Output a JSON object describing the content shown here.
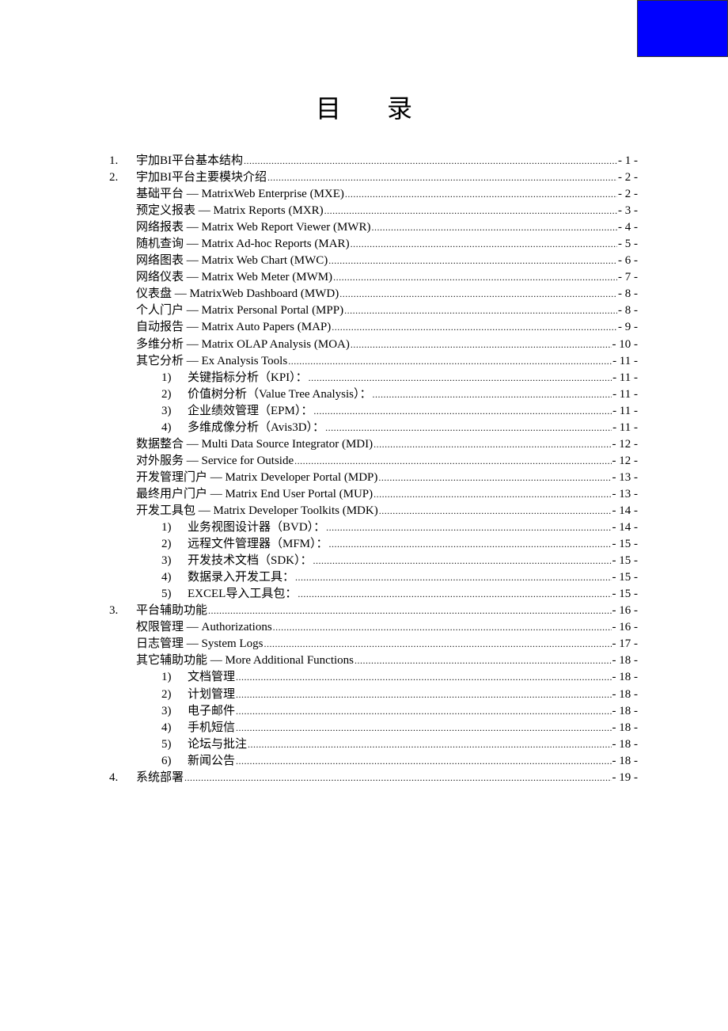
{
  "page": {
    "title_chars": [
      "目",
      "录"
    ],
    "corner_block_color": "#0000ff"
  },
  "toc": [
    {
      "level": 1,
      "num": "1.",
      "label": "宇加BI平台基本结构",
      "page": "- 1 -"
    },
    {
      "level": 1,
      "num": "2.",
      "label": "宇加BI平台主要模块介绍",
      "page": "- 2 -"
    },
    {
      "level": 2,
      "num": "",
      "label": "基础平台  — MatrixWeb Enterprise (MXE)",
      "page": "- 2 -"
    },
    {
      "level": 2,
      "num": "",
      "label": "预定义报表  — Matrix Reports (MXR)",
      "page": "- 3 -"
    },
    {
      "level": 2,
      "num": "",
      "label": "网络报表  — Matrix Web Report Viewer (MWR)",
      "page": "- 4 -"
    },
    {
      "level": 2,
      "num": "",
      "label": "随机查询  — Matrix Ad-hoc Reports (MAR)",
      "page": "- 5 -"
    },
    {
      "level": 2,
      "num": "",
      "label": "网络图表  — Matrix Web Chart (MWC)",
      "page": "- 6 -"
    },
    {
      "level": 2,
      "num": "",
      "label": "网络仪表  — Matrix Web Meter (MWM)",
      "page": "- 7 -"
    },
    {
      "level": 2,
      "num": "",
      "label": "仪表盘  — MatrixWeb Dashboard (MWD)",
      "page": "- 8 -"
    },
    {
      "level": 2,
      "num": "",
      "label": "个人门户  — Matrix Personal Portal (MPP)",
      "page": "- 8 -"
    },
    {
      "level": 2,
      "num": "",
      "label": "自动报告  — Matrix Auto Papers (MAP)",
      "page": "- 9 -"
    },
    {
      "level": 2,
      "num": "",
      "label": "多维分析  — Matrix OLAP Analysis (MOA)",
      "page": "- 10 -"
    },
    {
      "level": 2,
      "num": "",
      "label": "其它分析  — Ex Analysis Tools",
      "page": "- 11 -"
    },
    {
      "level": 3,
      "num": "1)",
      "label": "关键指标分析（KPI）：",
      "page": "- 11 -"
    },
    {
      "level": 3,
      "num": "2)",
      "label": "价值树分析（Value Tree Analysis）：",
      "page": "- 11 -"
    },
    {
      "level": 3,
      "num": "3)",
      "label": "企业绩效管理（EPM）：",
      "page": "- 11 -"
    },
    {
      "level": 3,
      "num": "4)",
      "label": "多维成像分析（Avis3D）：",
      "page": "- 11 -"
    },
    {
      "level": 2,
      "num": "",
      "label": "数据整合  — Multi Data Source Integrator (MDI)",
      "page": "- 12 -"
    },
    {
      "level": 2,
      "num": "",
      "label": "对外服务  — Service for Outside",
      "page": "- 12 -"
    },
    {
      "level": 2,
      "num": "",
      "label": "开发管理门户  — Matrix Developer Portal (MDP)",
      "page": "- 13 -"
    },
    {
      "level": 2,
      "num": "",
      "label": "最终用户门户  — Matrix End User Portal (MUP)",
      "page": "- 13 -"
    },
    {
      "level": 2,
      "num": "",
      "label": "开发工具包  — Matrix Developer Toolkits (MDK)",
      "page": "- 14 -"
    },
    {
      "level": 3,
      "num": "1)",
      "label": "业务视图设计器（BVD）：",
      "page": "- 14 -"
    },
    {
      "level": 3,
      "num": "2)",
      "label": "远程文件管理器（MFM）：",
      "page": "- 15 -"
    },
    {
      "level": 3,
      "num": "3)",
      "label": "开发技术文档（SDK）：",
      "page": "- 15 -"
    },
    {
      "level": 3,
      "num": "4)",
      "label": "数据录入开发工具：",
      "page": "- 15 -"
    },
    {
      "level": 3,
      "num": "5)",
      "label": "EXCEL导入工具包：",
      "page": "- 15 -"
    },
    {
      "level": 1,
      "num": "3.",
      "label": "平台辅助功能",
      "page": "- 16 -"
    },
    {
      "level": 2,
      "num": "",
      "label": "权限管理  — Authorizations",
      "page": "- 16 -"
    },
    {
      "level": 2,
      "num": "",
      "label": "日志管理  — System Logs",
      "page": "- 17 -"
    },
    {
      "level": 2,
      "num": "",
      "label": "其它辅助功能  — More Additional Functions",
      "page": "- 18 -"
    },
    {
      "level": 3,
      "num": "1)",
      "label": "文档管理",
      "page": "- 18 -"
    },
    {
      "level": 3,
      "num": "2)",
      "label": "计划管理",
      "page": "- 18 -"
    },
    {
      "level": 3,
      "num": "3)",
      "label": "电子邮件",
      "page": "- 18 -"
    },
    {
      "level": 3,
      "num": "4)",
      "label": "手机短信",
      "page": "- 18 -"
    },
    {
      "level": 3,
      "num": "5)",
      "label": "论坛与批注",
      "page": "- 18 -"
    },
    {
      "level": 3,
      "num": "6)",
      "label": "新闻公告",
      "page": "- 18 -"
    },
    {
      "level": 1,
      "num": "4.",
      "label": "系统部署",
      "page": "- 19 -"
    }
  ]
}
